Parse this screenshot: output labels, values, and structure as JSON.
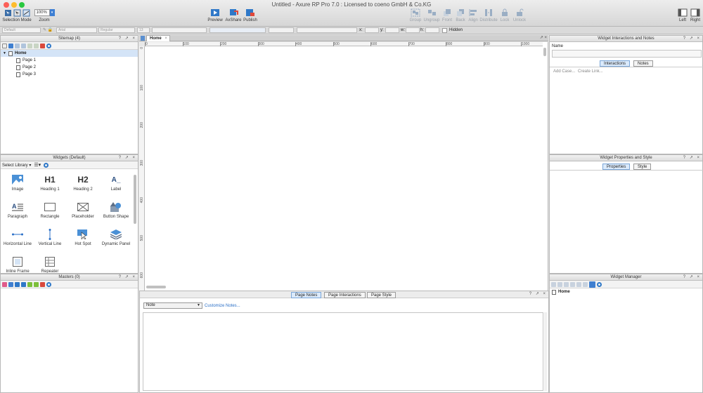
{
  "window": {
    "title": "Untitled - Axure RP Pro 7.0 : Licensed to coeno GmbH & Co.KG"
  },
  "toolbar": {
    "selection_mode": "Selection Mode",
    "zoom_label": "Zoom",
    "zoom_value": "100%",
    "preview": "Preview",
    "axshare": "AxShare",
    "publish": "Publish",
    "group": "Group",
    "ungroup": "Ungroup",
    "front": "Front",
    "back": "Back",
    "align": "Align",
    "distribute": "Distribute",
    "lock": "Lock",
    "unlock": "Unlock",
    "left": "Left",
    "right": "Right"
  },
  "format_bar": {
    "style": "Default",
    "font": "Arial",
    "weight": "Regular",
    "size": "13",
    "x_label": "x:",
    "y_label": "y:",
    "w_label": "w:",
    "h_label": "h:",
    "hidden_label": "Hidden"
  },
  "sitemap": {
    "title": "Sitemap (4)",
    "pages": [
      {
        "label": "Home"
      },
      {
        "label": "Page 1"
      },
      {
        "label": "Page 2"
      },
      {
        "label": "Page 3"
      }
    ]
  },
  "widgets": {
    "title": "Widgets (Default)",
    "library_label": "Select Library",
    "items": [
      {
        "label": "Image"
      },
      {
        "label": "Heading 1",
        "glyph": "H1"
      },
      {
        "label": "Heading 2",
        "glyph": "H2"
      },
      {
        "label": "Label",
        "glyph": "A_"
      },
      {
        "label": "Paragraph"
      },
      {
        "label": "Rectangle"
      },
      {
        "label": "Placeholder"
      },
      {
        "label": "Button Shape"
      },
      {
        "label": "Horizontal Line"
      },
      {
        "label": "Vertical Line"
      },
      {
        "label": "Hot Spot"
      },
      {
        "label": "Dynamic Panel"
      },
      {
        "label": "Inline Frame"
      },
      {
        "label": "Repeater"
      }
    ]
  },
  "masters": {
    "title": "Masters (0)"
  },
  "canvas": {
    "tab": "Home",
    "hruler": [
      "0",
      "100",
      "200",
      "300",
      "400",
      "500",
      "600",
      "700",
      "800",
      "900",
      "1000"
    ],
    "vruler": [
      "0",
      "100",
      "200",
      "300",
      "400",
      "500",
      "600"
    ]
  },
  "notes": {
    "tabs": [
      "Page Notes",
      "Page Interactions",
      "Page Style"
    ],
    "select_value": "Note",
    "customize": "Customize Notes..."
  },
  "interactions": {
    "title": "Widget Interactions and Notes",
    "name_label": "Name",
    "tabs": [
      "Interactions",
      "Notes"
    ],
    "add_case": "Add Case...",
    "create_link": "Create Link..."
  },
  "properties": {
    "title": "Widget Properties and Style",
    "tabs": [
      "Properties",
      "Style"
    ]
  },
  "manager": {
    "title": "Widget Manager",
    "root": "Home"
  }
}
